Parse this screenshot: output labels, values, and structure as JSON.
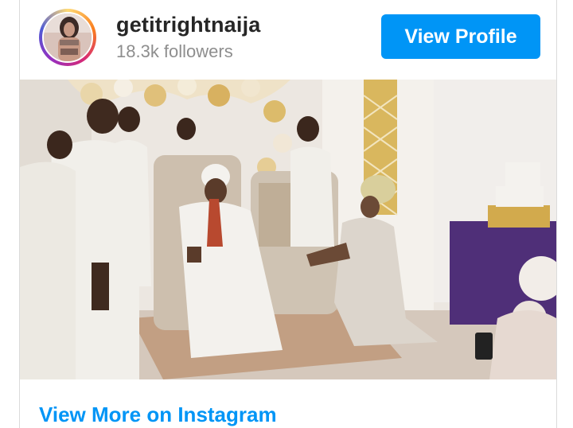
{
  "profile": {
    "username": "getitrightnaija",
    "followers": "18.3k followers",
    "view_profile_label": "View Profile"
  },
  "media": {
    "alt": "Video still of a woman in a silver gown kneeling with a microphone before a man in white royal attire seated on a throne, surrounded by attendants in white"
  },
  "footer": {
    "link_label": "View More on Instagram"
  },
  "colors": {
    "accent": "#0095f6",
    "username": "#262626",
    "secondary_text": "#8e8e8e"
  }
}
